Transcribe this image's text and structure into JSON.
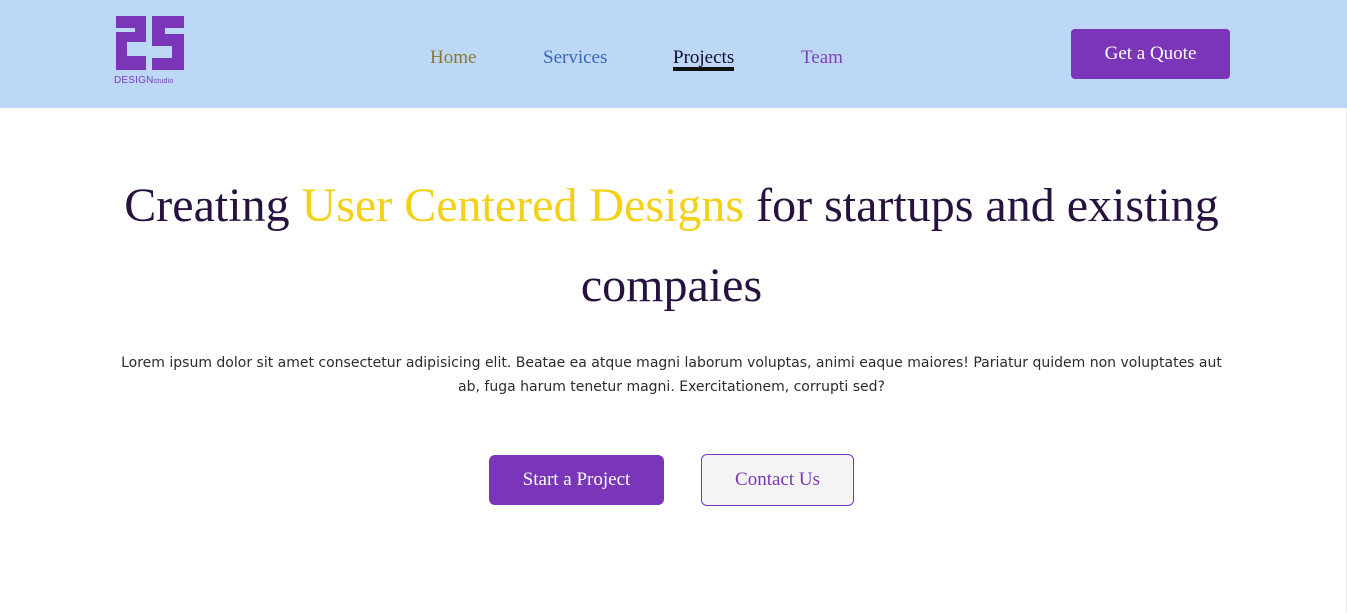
{
  "header": {
    "logo": {
      "mark": "2S",
      "word_main": "DESIGN",
      "word_small": "studio"
    },
    "nav": {
      "home": "Home",
      "services": "Services",
      "projects": "Projects",
      "team": "Team",
      "active": "Projects"
    },
    "cta_label": "Get a Quote"
  },
  "hero": {
    "title_before": "Creating ",
    "title_accent": "User Centered Designs",
    "title_after": " for startups and existing compaies",
    "description": "Lorem ipsum dolor sit amet consectetur adipisicing elit. Beatae ea atque magni laborum voluptas, animi eaque maiores! Pariatur quidem non voluptates aut ab, fuga harum tenetur magni. Exercitationem, corrupti sed?",
    "primary_button": "Start a Project",
    "secondary_button": "Contact Us"
  },
  "colors": {
    "header_bg": "#bdd8f6",
    "brand_purple": "#7a35b8",
    "accent_yellow": "#f3d116",
    "title_dark": "#27123f"
  }
}
